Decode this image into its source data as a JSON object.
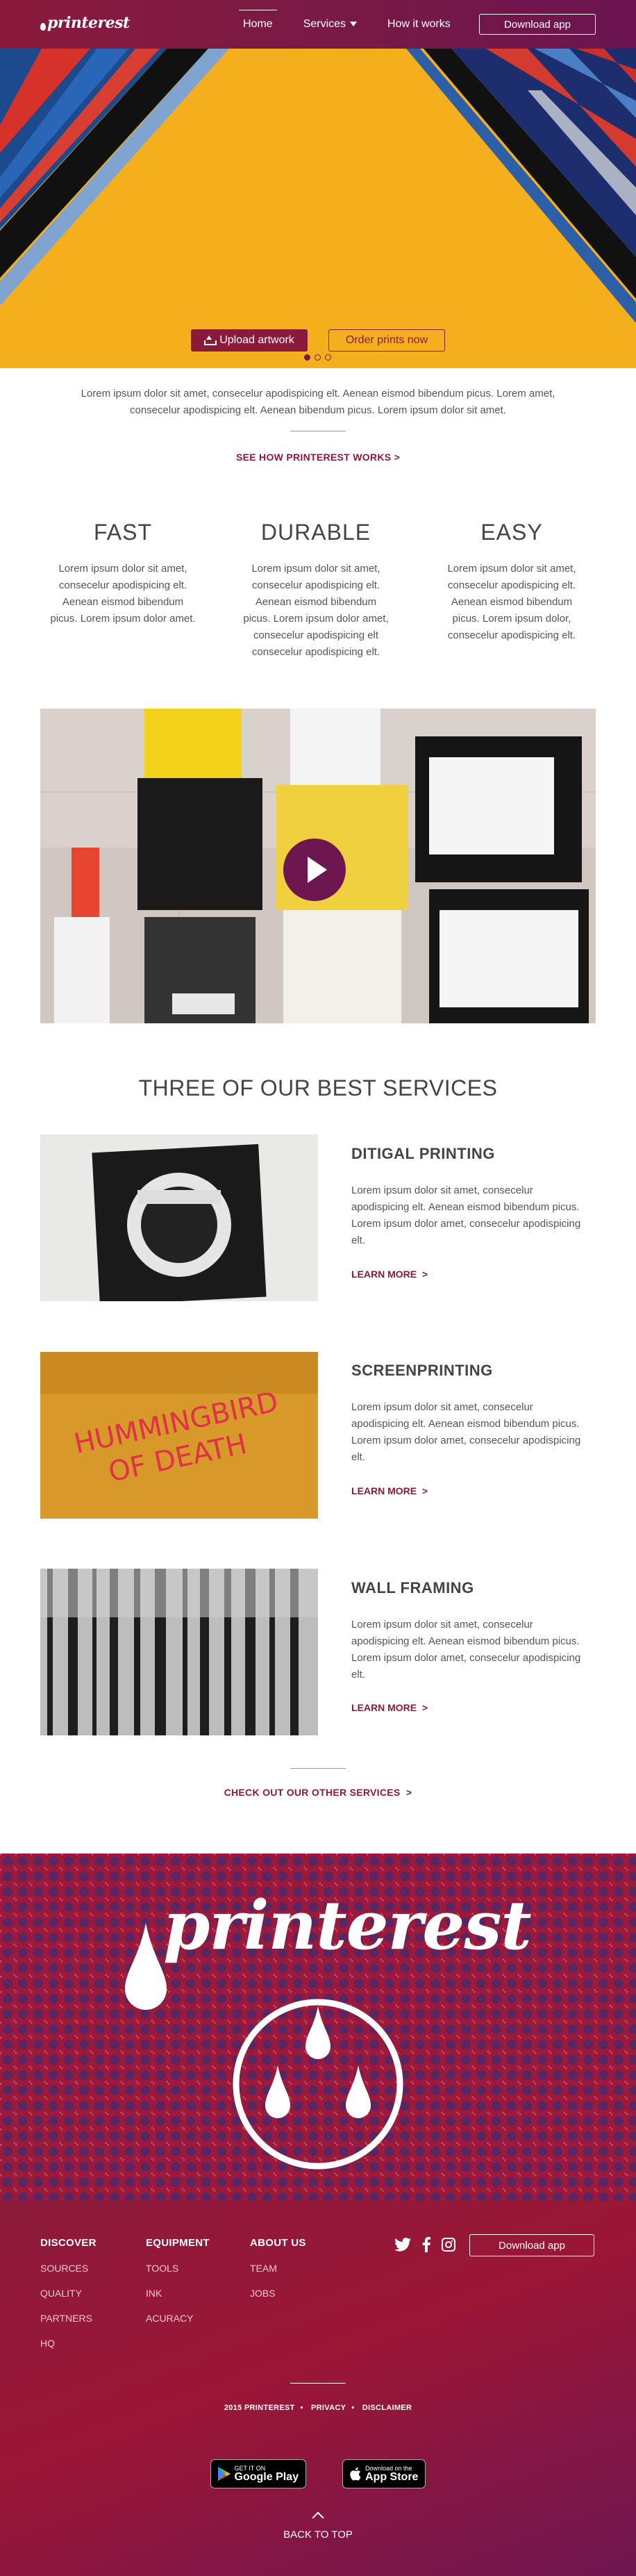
{
  "nav": {
    "logo": "printerest",
    "links": [
      "Home",
      "Services",
      "How it works"
    ],
    "cta": "Download app"
  },
  "hero": {
    "slide_count": 3,
    "active_slide": 1,
    "upload_label": "Upload artwork",
    "order_label": "Order prints now"
  },
  "intro": {
    "text": "Lorem ipsum dolor sit amet, consecelur apodispicing elt. Aenean eismod bibendum picus. Lorem amet, consecelur apodispicing elt. Aenean  bibendum picus. Lorem ipsum dolor sit amet.",
    "link": "SEE HOW PRINTEREST WORKS"
  },
  "features": [
    {
      "title": "FAST",
      "text": "Lorem ipsum dolor sit amet, consecelur apodispicing elt. Aenean eismod bibendum picus. Lorem ipsum dolor amet."
    },
    {
      "title": "DURABLE",
      "text": "Lorem ipsum dolor sit amet, consecelur apodispicing elt. Aenean eismod bibendum picus. Lorem ipsum dolor amet, consecelur apodispicing elt consecelur apodispicing elt."
    },
    {
      "title": "EASY",
      "text": "Lorem ipsum dolor sit amet, consecelur apodispicing elt. Aenean eismod bibendum picus. Lorem ipsum dolor, consecelur apodispicing elt."
    }
  ],
  "services": {
    "title": "THREE OF OUR BEST SERVICES",
    "items": [
      {
        "title": "DITIGAL PRINTING",
        "text": "Lorem ipsum dolor sit amet, consecelur apodispicing elt. Aenean eismod bibendum picus. Lorem ipsum dolor  amet, consecelur apodispicing elt.",
        "link": "LEARN MORE"
      },
      {
        "title": "SCREENPRINTING",
        "text": "Lorem ipsum dolor sit amet, consecelur apodispicing elt. Aenean eismod bibendum picus. Lorem ipsum dolor  amet, consecelur apodispicing elt.",
        "link": "LEARN MORE"
      },
      {
        "title": "WALL FRAMING",
        "text": "Lorem ipsum dolor sit amet, consecelur apodispicing elt. Aenean eismod bibendum picus. Lorem ipsum dolor  amet, consecelur apodispicing elt.",
        "link": "LEARN MORE"
      }
    ],
    "more_link": "CHECK OUT OUR OTHER SERVICES"
  },
  "banner": {
    "word": "printerest"
  },
  "footer": {
    "columns": [
      {
        "title": "DISCOVER",
        "items": [
          "SOURCES",
          "QUALITY",
          "PARTNERS",
          "HQ"
        ]
      },
      {
        "title": "EQUIPMENT",
        "items": [
          "TOOLS",
          "INK",
          "ACURACY"
        ]
      },
      {
        "title": "ABOUT US",
        "items": [
          "TEAM",
          "JOBS"
        ]
      }
    ],
    "cta": "Download app",
    "legal": [
      "2015 PRINTEREST",
      "PRIVACY",
      "DISCLAIMER"
    ],
    "google_small": "GET IT ON",
    "google_big": "Google Play",
    "apple_small": "Download on the",
    "apple_big": "App Store",
    "back_to_top": "BACK TO TOP"
  },
  "colors": {
    "brand": "#8a1a3c",
    "hero_bg": "#f6b01b",
    "purple": "#6d1650"
  }
}
